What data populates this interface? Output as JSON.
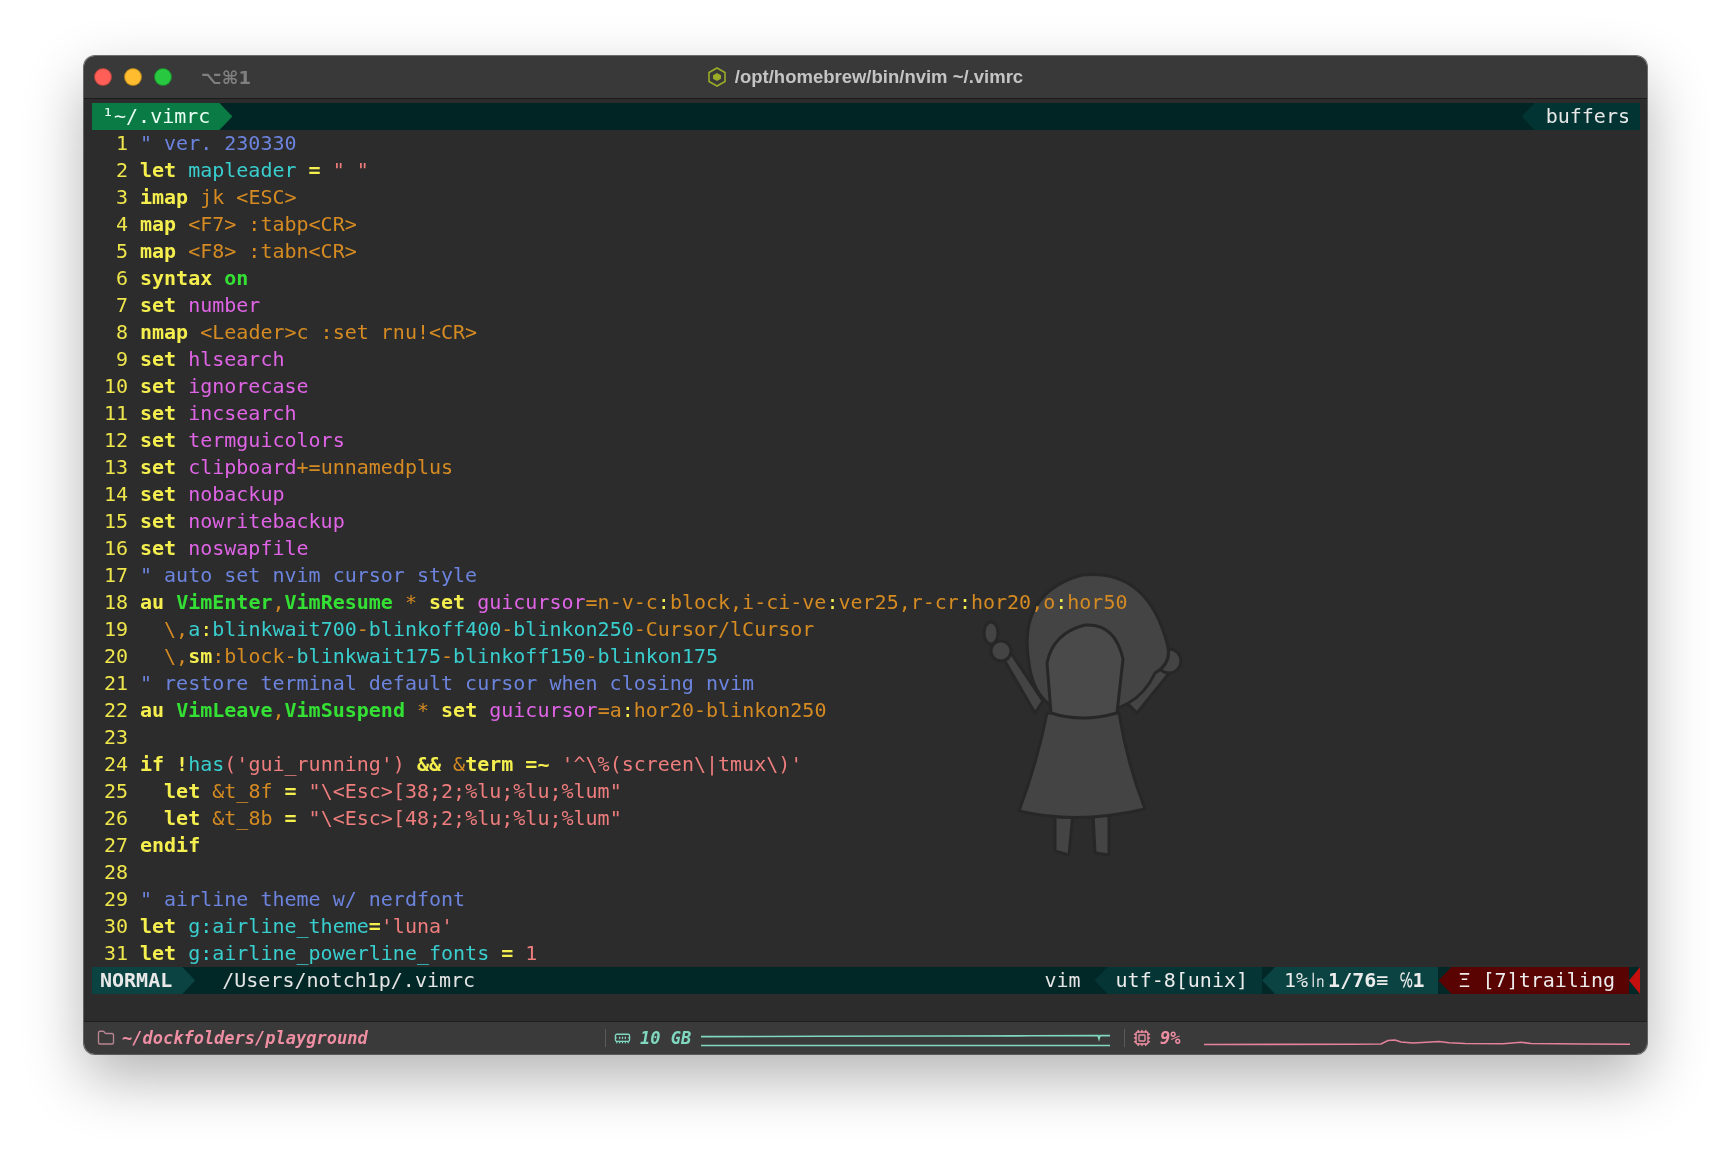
{
  "window": {
    "shortcut": "⌥⌘1",
    "title": "/opt/homebrew/bin/nvim ~/.vimrc"
  },
  "tabline": {
    "tabs": [
      {
        "label": "¹~/.vimrc",
        "selected": true
      }
    ],
    "right_label": "buffers"
  },
  "editor": {
    "lines": [
      {
        "number": "1",
        "tokens": [
          {
            "text": "\" ver. 230330",
            "kind": "comment"
          }
        ]
      },
      {
        "number": "2",
        "tokens": [
          {
            "text": "let",
            "kind": "keyword"
          },
          {
            "text": " mapleader",
            "kind": "identifier"
          },
          {
            "text": " =",
            "kind": "keyword"
          },
          {
            "text": " \" \"",
            "kind": "string"
          }
        ]
      },
      {
        "number": "3",
        "tokens": [
          {
            "text": "imap",
            "kind": "keyword"
          },
          {
            "text": " jk <ESC>",
            "kind": "argument"
          }
        ]
      },
      {
        "number": "4",
        "tokens": [
          {
            "text": "map",
            "kind": "keyword"
          },
          {
            "text": " <F7> :tabp<CR>",
            "kind": "argument"
          }
        ]
      },
      {
        "number": "5",
        "tokens": [
          {
            "text": "map",
            "kind": "keyword"
          },
          {
            "text": " <F8> :tabn<CR>",
            "kind": "argument"
          }
        ]
      },
      {
        "number": "6",
        "tokens": [
          {
            "text": "syntax",
            "kind": "keyword"
          },
          {
            "text": " on",
            "kind": "constant"
          }
        ]
      },
      {
        "number": "7",
        "tokens": [
          {
            "text": "set",
            "kind": "keyword"
          },
          {
            "text": " number",
            "kind": "option"
          }
        ]
      },
      {
        "number": "8",
        "tokens": [
          {
            "text": "nmap",
            "kind": "keyword"
          },
          {
            "text": " <Leader>c :set rnu!<CR>",
            "kind": "argument"
          }
        ]
      },
      {
        "number": "9",
        "tokens": [
          {
            "text": "set",
            "kind": "keyword"
          },
          {
            "text": " hlsearch",
            "kind": "option"
          }
        ]
      },
      {
        "number": "10",
        "tokens": [
          {
            "text": "set",
            "kind": "keyword"
          },
          {
            "text": " ignorecase",
            "kind": "option"
          }
        ]
      },
      {
        "number": "11",
        "tokens": [
          {
            "text": "set",
            "kind": "keyword"
          },
          {
            "text": " incsearch",
            "kind": "option"
          }
        ]
      },
      {
        "number": "12",
        "tokens": [
          {
            "text": "set",
            "kind": "keyword"
          },
          {
            "text": " termguicolors",
            "kind": "option"
          }
        ]
      },
      {
        "number": "13",
        "tokens": [
          {
            "text": "set",
            "kind": "keyword"
          },
          {
            "text": " clipboard",
            "kind": "option"
          },
          {
            "text": "+=unnamedplus",
            "kind": "argument"
          }
        ]
      },
      {
        "number": "14",
        "tokens": [
          {
            "text": "set",
            "kind": "keyword"
          },
          {
            "text": " nobackup",
            "kind": "option"
          }
        ]
      },
      {
        "number": "15",
        "tokens": [
          {
            "text": "set",
            "kind": "keyword"
          },
          {
            "text": " nowritebackup",
            "kind": "option"
          }
        ]
      },
      {
        "number": "16",
        "tokens": [
          {
            "text": "set",
            "kind": "keyword"
          },
          {
            "text": " noswapfile",
            "kind": "option"
          }
        ]
      },
      {
        "number": "17",
        "tokens": [
          {
            "text": "\" auto set nvim cursor style",
            "kind": "comment"
          }
        ]
      },
      {
        "number": "18",
        "tokens": [
          {
            "text": "au",
            "kind": "keyword"
          },
          {
            "text": " VimEnter",
            "kind": "constant"
          },
          {
            "text": ",",
            "kind": "argument"
          },
          {
            "text": "VimResume",
            "kind": "constant"
          },
          {
            "text": " *",
            "kind": "argument"
          },
          {
            "text": " set",
            "kind": "keyword"
          },
          {
            "text": " guicursor",
            "kind": "option"
          },
          {
            "text": "=n-v-c",
            "kind": "argument"
          },
          {
            "text": ":",
            "kind": "operator"
          },
          {
            "text": "block,i-ci-ve",
            "kind": "argument"
          },
          {
            "text": ":",
            "kind": "operator"
          },
          {
            "text": "ver25,r-cr",
            "kind": "argument"
          },
          {
            "text": ":",
            "kind": "operator"
          },
          {
            "text": "hor20,o",
            "kind": "argument"
          },
          {
            "text": ":",
            "kind": "operator"
          },
          {
            "text": "hor50",
            "kind": "argument"
          }
        ]
      },
      {
        "number": "19",
        "tokens": [
          {
            "text": "  \\,",
            "kind": "argument"
          },
          {
            "text": "a",
            "kind": "identifier"
          },
          {
            "text": ":",
            "kind": "operator"
          },
          {
            "text": "blinkwait700",
            "kind": "identifier"
          },
          {
            "text": "-",
            "kind": "argument"
          },
          {
            "text": "blinkoff400",
            "kind": "identifier"
          },
          {
            "text": "-",
            "kind": "argument"
          },
          {
            "text": "blinkon250",
            "kind": "identifier"
          },
          {
            "text": "-Cursor/lCursor",
            "kind": "argument"
          }
        ]
      },
      {
        "number": "20",
        "tokens": [
          {
            "text": "  \\,",
            "kind": "argument"
          },
          {
            "text": "sm",
            "kind": "keyword"
          },
          {
            "text": ":block-",
            "kind": "argument"
          },
          {
            "text": "blinkwait175",
            "kind": "identifier"
          },
          {
            "text": "-",
            "kind": "argument"
          },
          {
            "text": "blinkoff150",
            "kind": "identifier"
          },
          {
            "text": "-",
            "kind": "argument"
          },
          {
            "text": "blinkon175",
            "kind": "identifier"
          }
        ]
      },
      {
        "number": "21",
        "tokens": [
          {
            "text": "\" restore terminal default cursor when closing nvim",
            "kind": "comment"
          }
        ]
      },
      {
        "number": "22",
        "tokens": [
          {
            "text": "au",
            "kind": "keyword"
          },
          {
            "text": " VimLeave",
            "kind": "constant"
          },
          {
            "text": ",",
            "kind": "argument"
          },
          {
            "text": "VimSuspend",
            "kind": "constant"
          },
          {
            "text": " *",
            "kind": "argument"
          },
          {
            "text": " set",
            "kind": "keyword"
          },
          {
            "text": " guicursor",
            "kind": "option"
          },
          {
            "text": "=a",
            "kind": "argument"
          },
          {
            "text": ":",
            "kind": "operator"
          },
          {
            "text": "hor20-blinkon250",
            "kind": "argument"
          }
        ]
      },
      {
        "number": "23"
      },
      {
        "number": "24",
        "tokens": [
          {
            "text": "if !",
            "kind": "keyword"
          },
          {
            "text": "has",
            "kind": "identifier"
          },
          {
            "text": "('gui_running')",
            "kind": "string"
          },
          {
            "text": " &&",
            "kind": "keyword"
          },
          {
            "text": " &",
            "kind": "argument"
          },
          {
            "text": "term",
            "kind": "keyword"
          },
          {
            "text": " =~",
            "kind": "keyword"
          },
          {
            "text": " '^\\%(screen\\|tmux\\)'",
            "kind": "string"
          }
        ]
      },
      {
        "number": "25",
        "tokens": [
          {
            "text": "  let",
            "kind": "keyword"
          },
          {
            "text": " &t_8f",
            "kind": "argument"
          },
          {
            "text": " =",
            "kind": "keyword"
          },
          {
            "text": " \"\\<Esc>[38;2;%lu;%lu;%lum\"",
            "kind": "string"
          }
        ]
      },
      {
        "number": "26",
        "tokens": [
          {
            "text": "  let",
            "kind": "keyword"
          },
          {
            "text": " &t_8b",
            "kind": "argument"
          },
          {
            "text": " =",
            "kind": "keyword"
          },
          {
            "text": " \"\\<Esc>[48;2;%lu;%lu;%lum\"",
            "kind": "string"
          }
        ]
      },
      {
        "number": "27",
        "tokens": [
          {
            "text": "endif",
            "kind": "keyword"
          }
        ]
      },
      {
        "number": "28"
      },
      {
        "number": "29",
        "tokens": [
          {
            "text": "\" airline theme w/ nerdfont",
            "kind": "comment"
          }
        ]
      },
      {
        "number": "30",
        "tokens": [
          {
            "text": "let",
            "kind": "keyword"
          },
          {
            "text": " g:airline_theme",
            "kind": "identifier"
          },
          {
            "text": "=",
            "kind": "keyword"
          },
          {
            "text": "'luna'",
            "kind": "string"
          }
        ]
      },
      {
        "number": "31",
        "tokens": [
          {
            "text": "let",
            "kind": "keyword"
          },
          {
            "text": " g:airline_powerline_fonts",
            "kind": "identifier"
          },
          {
            "text": " =",
            "kind": "keyword"
          },
          {
            "text": " 1",
            "kind": "string"
          }
        ]
      }
    ]
  },
  "statusline": {
    "mode": "NORMAL",
    "file": "/Users/notch1p/.vimrc",
    "filetype": "vim",
    "encoding": "utf-8[unix]",
    "position": "1%㏑**1/76**≡ ℅**1**",
    "warning": "Ξ [7]trailing"
  },
  "bottom_bar": {
    "directory": "~/dockfolders/playground",
    "memory": "10 GB",
    "cpu": "9%"
  }
}
